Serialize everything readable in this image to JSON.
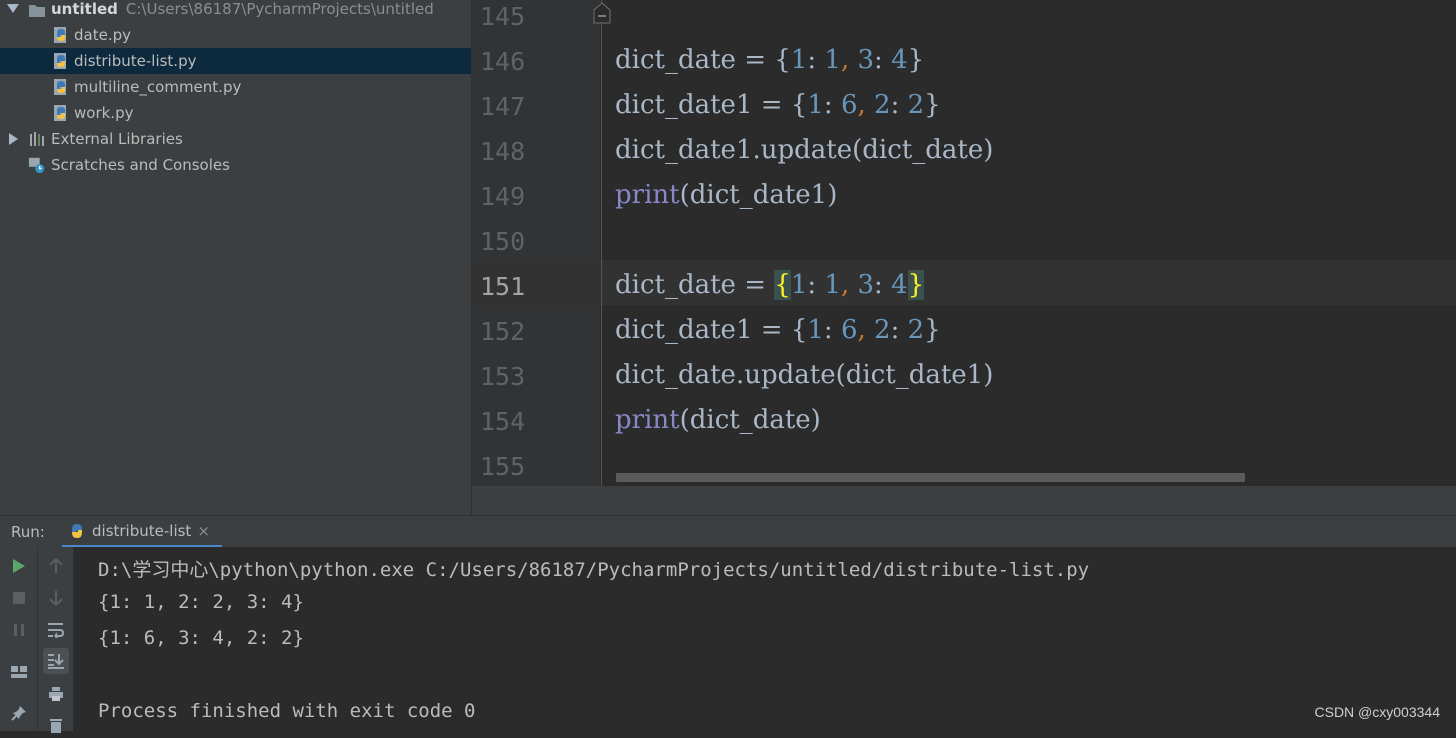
{
  "project": {
    "root_name": "untitled",
    "root_path": "C:\\Users\\86187\\PycharmProjects\\untitled",
    "files": [
      "date.py",
      "distribute-list.py",
      "multiline_comment.py",
      "work.py"
    ],
    "selected_file": "distribute-list.py",
    "external_libraries": "External Libraries",
    "scratches": "Scratches and Consoles"
  },
  "editor": {
    "line_numbers": [
      "145",
      "146",
      "147",
      "148",
      "149",
      "150",
      "151",
      "152",
      "153",
      "154",
      "155"
    ],
    "current_line": "151",
    "docstring_tail": "\"\"\"",
    "code": {
      "l146": {
        "name": "dict_date",
        "assign": " = ",
        "open": "{",
        "k1": "1",
        "c1": ": ",
        "v1": "1",
        "sep": ", ",
        "k2": "3",
        "c2": ": ",
        "v2": "4",
        "close": "}"
      },
      "l147": {
        "name": "dict_date1",
        "assign": " = ",
        "open": "{",
        "k1": "1",
        "c1": ": ",
        "v1": "6",
        "sep": ", ",
        "k2": "2",
        "c2": ": ",
        "v2": "2",
        "close": "}"
      },
      "l148": {
        "text": "dict_date1.update(dict_date)"
      },
      "l149": {
        "fn": "print",
        "args": "(dict_date1)"
      },
      "l151": {
        "name": "dict_date",
        "assign": " = ",
        "open": "{",
        "k1": "1",
        "c1": ": ",
        "v1": "1",
        "sep": ", ",
        "k2": "3",
        "c2": ": ",
        "v2": "4",
        "close": "}"
      },
      "l152": {
        "name": "dict_date1",
        "assign": " = ",
        "open": "{",
        "k1": "1",
        "c1": ": ",
        "v1": "6",
        "sep": ", ",
        "k2": "2",
        "c2": ": ",
        "v2": "2",
        "close": "}"
      },
      "l153": {
        "text": "dict_date.update(dict_date1)"
      },
      "l154": {
        "fn": "print",
        "args": "(dict_date)"
      }
    }
  },
  "run": {
    "title": "Run:",
    "tab_label": "distribute-list",
    "tab_close": "×",
    "output": [
      "D:\\学习中心\\python\\python.exe C:/Users/86187/PycharmProjects/untitled/distribute-list.py",
      "{1: 1, 2: 2, 3: 4}",
      "{1: 6, 3: 4, 2: 2}",
      "",
      "Process finished with exit code 0"
    ]
  },
  "watermark": "CSDN @cxy003344",
  "colors": {
    "background": "#2b2b2b",
    "panel": "#3c3f41",
    "selection": "#0d293e",
    "keyword_print": "#8888c6",
    "number": "#6897bb",
    "punctuation": "#cc7832",
    "brace_match": "#ffef28",
    "run_green": "#59a869"
  },
  "icons": [
    "python-file-icon",
    "library-icon",
    "scratches-icon",
    "run-icon",
    "stop-icon",
    "pause-icon",
    "up-icon",
    "down-icon",
    "soft-wrap-icon",
    "scroll-to-end-icon",
    "print-icon",
    "layout-icon",
    "pin-icon",
    "trash-icon"
  ]
}
